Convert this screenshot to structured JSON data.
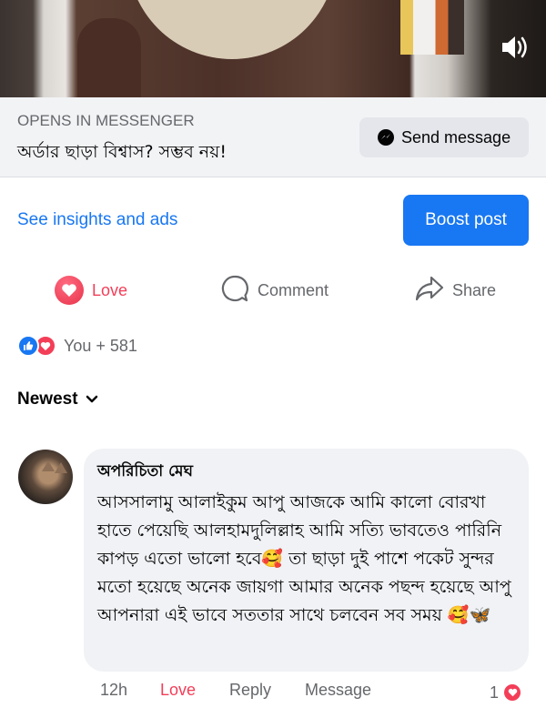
{
  "cta": {
    "caption": "OPENS IN MESSENGER",
    "tagline": "অর্ডার ছাড়া বিশ্বাস? সম্ভব নয়!",
    "send_label": "Send message"
  },
  "insights": {
    "link": "See insights and ads",
    "boost_label": "Boost post"
  },
  "actions": {
    "love": "Love",
    "comment": "Comment",
    "share": "Share"
  },
  "reactions": {
    "count_label": "You + 581"
  },
  "sort": {
    "label": "Newest"
  },
  "comment": {
    "author": "অপরিচিতা মেঘ",
    "text": "আসসালামু আলাইকুম আপু আজকে আমি কালো বোরখা হাতে পেয়েছি আলহামদুলিল্লাহ আমি সত্যি ভাবতেও পারিনি কাপড় এতো ভালো হবে🥰 তা ছাড়া দুই পাশে পকেট সুন্দর মতো হয়েছে অনেক জায়গা আমার অনেক পছন্দ হয়েছে আপু আপনারা এই ভাবে সততার সাথে চলবেন সব সময় 🥰🦋",
    "time": "12h",
    "love_label": "Love",
    "reply_label": "Reply",
    "message_label": "Message",
    "reaction_count": "1"
  },
  "colors": {
    "accent": "#1877f2",
    "love": "#f33e58",
    "secondary_text": "#65676b"
  }
}
